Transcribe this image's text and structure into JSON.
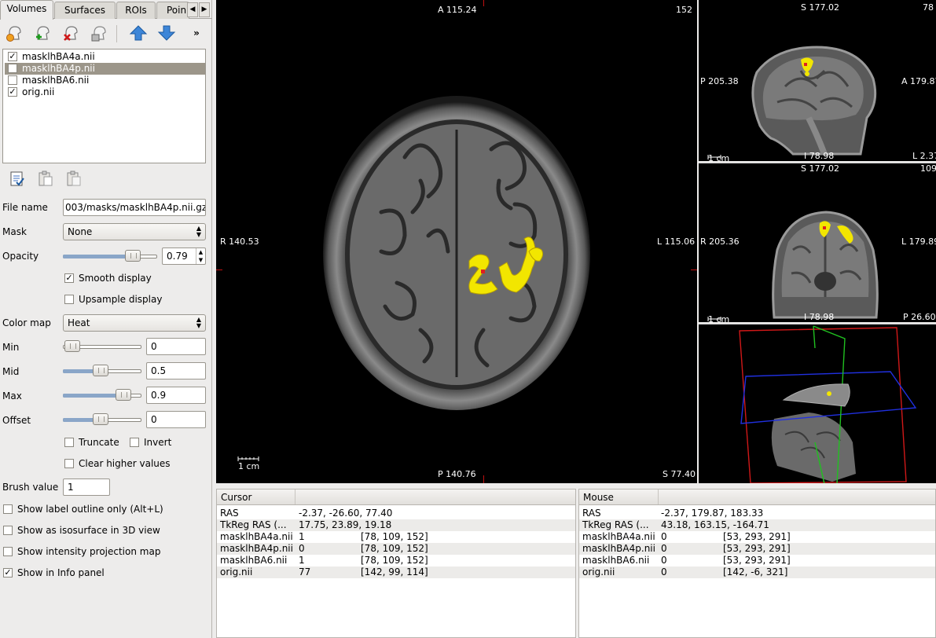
{
  "tabs": [
    "Volumes",
    "Surfaces",
    "ROIs",
    "Poin"
  ],
  "layers": [
    {
      "name": "masklhBA4a.nii",
      "checked": true,
      "selected": false
    },
    {
      "name": "masklhBA4p.nii",
      "checked": false,
      "selected": true
    },
    {
      "name": "masklhBA6.nii",
      "checked": false,
      "selected": false
    },
    {
      "name": "orig.nii",
      "checked": true,
      "selected": false
    }
  ],
  "properties": {
    "file_name_label": "File name",
    "file_name_value": "003/masks/masklhBA4p.nii.gz",
    "mask_label": "Mask",
    "mask_value": "None",
    "opacity_label": "Opacity",
    "opacity_value": "0.79",
    "opacity_level": 0.79,
    "smooth_display": "Smooth display",
    "upsample_display": "Upsample display",
    "color_map_label": "Color map",
    "color_map_value": "Heat",
    "min_label": "Min",
    "min_value": "0",
    "mid_label": "Mid",
    "mid_value": "0.5",
    "max_label": "Max",
    "max_value": "0.9",
    "offset_label": "Offset",
    "offset_value": "0",
    "truncate": "Truncate",
    "invert": "Invert",
    "clear_higher": "Clear higher values",
    "brush_value_label": "Brush value",
    "brush_value": "1",
    "show_label_outline": "Show label outline only (Alt+L)",
    "show_isosurface": "Show as isosurface in 3D view",
    "show_intensity_projection": "Show intensity projection map",
    "show_in_info_panel": "Show in Info panel"
  },
  "main_view": {
    "top": "A 115.24",
    "top_right": "152",
    "left": "R 140.53",
    "right": "L 115.06",
    "bottom": "P 140.76",
    "bottom_right": "S 77.40",
    "scale": "1 cm"
  },
  "sagittal_view": {
    "top": "S 177.02",
    "top_right": "78",
    "left": "P 205.38",
    "right": "A 179.87",
    "bottom": "I 78.98",
    "bottom_right": "L 2.37",
    "scale": "1 cm"
  },
  "coronal_view": {
    "top": "S 177.02",
    "top_right": "109",
    "left": "R 205.36",
    "right": "L 179.89",
    "bottom": "I 78.98",
    "bottom_right": "P 26.60",
    "scale": "1 cm"
  },
  "cursor_panel": {
    "title": "Cursor",
    "rows": [
      {
        "label": "RAS",
        "value": "-2.37, -26.60, 77.40",
        "coord": ""
      },
      {
        "label": "TkReg RAS (...",
        "value": "17.75, 23.89, 19.18",
        "coord": ""
      },
      {
        "label": "masklhBA4a.nii",
        "value": "1",
        "coord": "[78, 109, 152]"
      },
      {
        "label": "masklhBA4p.nii",
        "value": "0",
        "coord": "[78, 109, 152]"
      },
      {
        "label": "masklhBA6.nii",
        "value": "1",
        "coord": "[78, 109, 152]"
      },
      {
        "label": "orig.nii",
        "value": "77",
        "coord": "[142, 99, 114]"
      }
    ]
  },
  "mouse_panel": {
    "title": "Mouse",
    "rows": [
      {
        "label": "RAS",
        "value": "-2.37, 179.87, 183.33",
        "coord": ""
      },
      {
        "label": "TkReg RAS (...",
        "value": "43.18, 163.15, -164.71",
        "coord": ""
      },
      {
        "label": "masklhBA4a.nii",
        "value": "0",
        "coord": "[53, 293, 291]"
      },
      {
        "label": "masklhBA4p.nii",
        "value": "0",
        "coord": "[53, 293, 291]"
      },
      {
        "label": "masklhBA6.nii",
        "value": "0",
        "coord": "[53, 293, 291]"
      },
      {
        "label": "orig.nii",
        "value": "0",
        "coord": "[142, -6, 321]"
      }
    ]
  },
  "colors": {
    "heat_overlay": "#f2e600",
    "cursor_red": "#c01010",
    "selection": "#9c968a"
  }
}
